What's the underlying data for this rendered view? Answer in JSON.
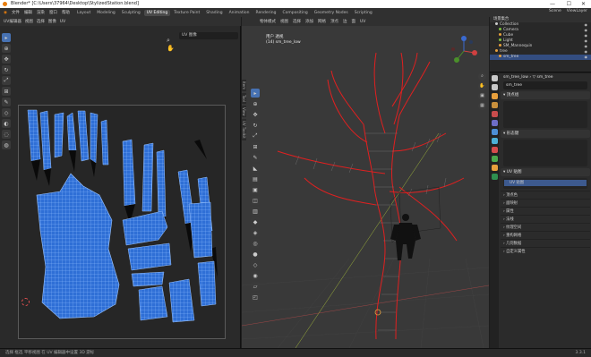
{
  "window": {
    "title": "Blender* [C:\\Users\\37964\\Desktop\\StylizedStation.blend]",
    "min_glyph": "—",
    "max_glyph": "☐",
    "close_glyph": "✕"
  },
  "menubar": {
    "items": [
      "文件",
      "编辑",
      "渲染",
      "窗口",
      "帮助"
    ],
    "workspaces": [
      "Layout",
      "Modeling",
      "Sculpting",
      "UV Editing",
      "Texture Paint",
      "Shading",
      "Animation",
      "Rendering",
      "Compositing",
      "Geometry Nodes",
      "Scripting"
    ],
    "active_workspace": "UV Editing",
    "scene_label": "Scene",
    "viewlayer_label": "ViewLayer"
  },
  "uv_editor": {
    "header_items": [
      "UV编辑器",
      "视图",
      "选择",
      "图像",
      "UV"
    ],
    "image_field": "UV 图像",
    "colors": {
      "island_fill": "#2f6fd6",
      "island_stroke": "#87b7ff"
    }
  },
  "viewport": {
    "header_items": [
      "物体模式",
      "视图",
      "选择",
      "添加",
      "网格",
      "顶点",
      "边",
      "面",
      "UV"
    ],
    "info_line1": "用户 透视",
    "info_line2": "(14) sm_tree_low",
    "side_tabs": [
      "Item",
      "Tool",
      "View",
      "UV Toolkit"
    ]
  },
  "outliner": {
    "title": "场景集合",
    "rows": [
      {
        "name": "Collection",
        "color": "#cccccc",
        "indent": 6,
        "selected": false
      },
      {
        "name": "Camera",
        "color": "#7fbf3f",
        "indent": 10,
        "selected": false
      },
      {
        "name": "Cube",
        "color": "#e8a03c",
        "indent": 10,
        "selected": false
      },
      {
        "name": "Light",
        "color": "#7fbf3f",
        "indent": 10,
        "selected": false
      },
      {
        "name": "SM_Mannequin",
        "color": "#e8a03c",
        "indent": 10,
        "selected": false
      },
      {
        "name": "tree",
        "color": "#e8a03c",
        "indent": 6,
        "selected": false
      },
      {
        "name": "sm_tree",
        "color": "#e8a03c",
        "indent": 10,
        "selected": true
      }
    ],
    "eye_glyph": "◉"
  },
  "properties": {
    "breadcrumb": "sm_tree_low  ›  ▽ sm_tree",
    "mesh_name": "sm_tree",
    "panels": [
      {
        "title": "▾ 顶点组",
        "has_box": true
      },
      {
        "title": "▾ 形态键",
        "has_box": true
      },
      {
        "title": "▾ UV 贴图",
        "has_box": false
      }
    ],
    "uvmap_item": "UV 贴图",
    "collapsed": [
      "› 顶点色",
      "› 面映射",
      "› 属性",
      "› 法线",
      "› 纹理空间",
      "› 重构网格",
      "› 几何数据",
      "› 自定义属性"
    ],
    "tab_colors": [
      "#c8c8c8",
      "#c8c8c8",
      "#e8a03c",
      "#c88f3c",
      "#c84c4c",
      "#6e6ec8",
      "#4c8fd6",
      "#4cb0d6",
      "#d64c4c",
      "#4ca84c",
      "#e8a03c",
      "#2f8f4f"
    ]
  },
  "statusbar": {
    "left": "选择  框选  平移视图  在 UV 编辑器中设置 3D 游标",
    "right": "3.3.1"
  }
}
